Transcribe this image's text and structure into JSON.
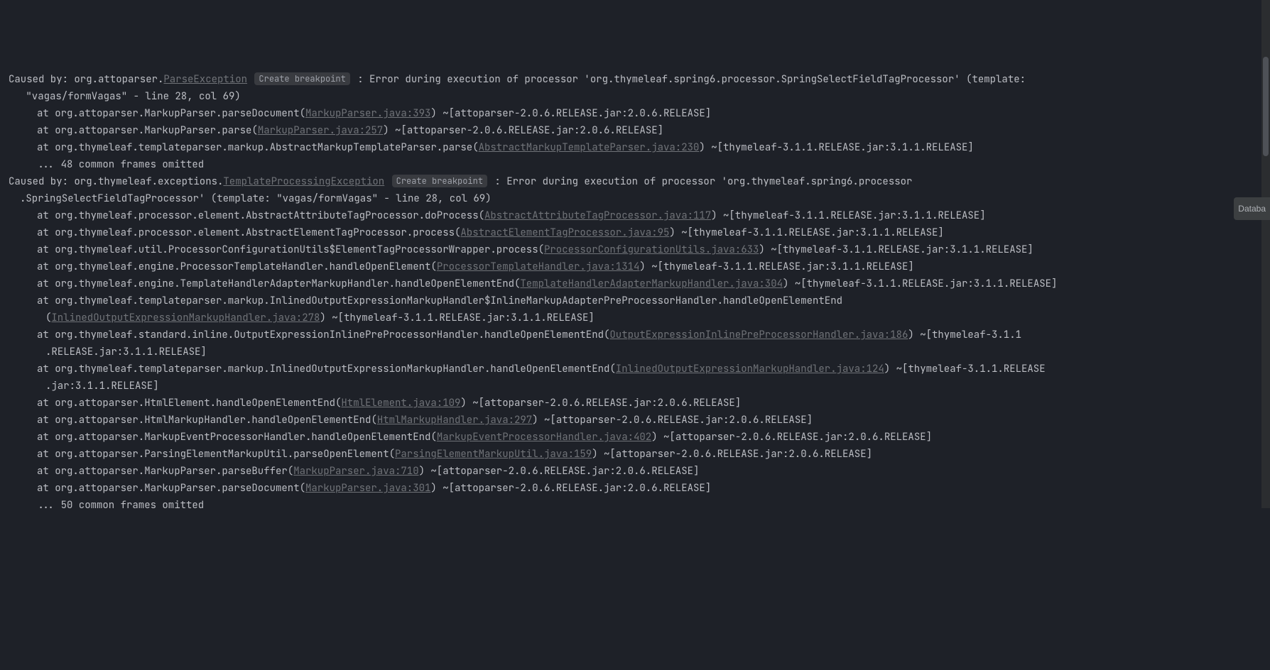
{
  "labels": {
    "create_breakpoint": "Create breakpoint",
    "database_tab": "Databa"
  },
  "lines": [
    {
      "indent": 0,
      "segs": [
        {
          "t": "Caused by: org.attoparser."
        },
        {
          "t": "ParseException",
          "link": true
        },
        {
          "t": " "
        },
        {
          "bp": true
        },
        {
          "t": " : Error during execution of processor 'org.thymeleaf.spring6.processor.SpringSelectFieldTagProcessor' (template:"
        }
      ]
    },
    {
      "indent": 1,
      "segs": [
        {
          "t": " \"vagas/formVagas\" - line 28, col 69)"
        }
      ]
    },
    {
      "indent": 2,
      "segs": [
        {
          "t": "at org.attoparser.MarkupParser.parseDocument("
        },
        {
          "t": "MarkupParser.java:393",
          "link": true
        },
        {
          "t": ") ~[attoparser-2.0.6.RELEASE.jar:2.0.6.RELEASE]"
        }
      ]
    },
    {
      "indent": 2,
      "segs": [
        {
          "t": "at org.attoparser.MarkupParser.parse("
        },
        {
          "t": "MarkupParser.java:257",
          "link": true
        },
        {
          "t": ") ~[attoparser-2.0.6.RELEASE.jar:2.0.6.RELEASE]"
        }
      ]
    },
    {
      "indent": 2,
      "segs": [
        {
          "t": "at org.thymeleaf.templateparser.markup.AbstractMarkupTemplateParser.parse("
        },
        {
          "t": "AbstractMarkupTemplateParser.java:230",
          "link": true
        },
        {
          "t": ") ~[thymeleaf-3.1.1.RELEASE.jar:3.1.1.RELEASE]"
        }
      ]
    },
    {
      "indent": 2,
      "segs": [
        {
          "t": "... 48 common frames omitted"
        }
      ]
    },
    {
      "indent": 0,
      "segs": [
        {
          "t": "Caused by: org.thymeleaf.exceptions."
        },
        {
          "t": "TemplateProcessingException",
          "link": true
        },
        {
          "t": " "
        },
        {
          "bp": true
        },
        {
          "t": " : Error during execution of processor 'org.thymeleaf.spring6.processor"
        }
      ]
    },
    {
      "indent": 1,
      "segs": [
        {
          "t": ".SpringSelectFieldTagProcessor' (template: \"vagas/formVagas\" - line 28, col 69)"
        }
      ]
    },
    {
      "indent": 2,
      "segs": [
        {
          "t": "at org.thymeleaf.processor.element.AbstractAttributeTagProcessor.doProcess("
        },
        {
          "t": "AbstractAttributeTagProcessor.java:117",
          "link": true
        },
        {
          "t": ") ~[thymeleaf-3.1.1.RELEASE.jar:3.1.1.RELEASE]"
        }
      ]
    },
    {
      "indent": 2,
      "segs": [
        {
          "t": "at org.thymeleaf.processor.element.AbstractElementTagProcessor.process("
        },
        {
          "t": "AbstractElementTagProcessor.java:95",
          "link": true
        },
        {
          "t": ") ~[thymeleaf-3.1.1.RELEASE.jar:3.1.1.RELEASE]"
        }
      ]
    },
    {
      "indent": 2,
      "segs": [
        {
          "t": "at org.thymeleaf.util.ProcessorConfigurationUtils$ElementTagProcessorWrapper.process("
        },
        {
          "t": "ProcessorConfigurationUtils.java:633",
          "link": true
        },
        {
          "t": ") ~[thymeleaf-3.1.1.RELEASE.jar:3.1.1.RELEASE]"
        }
      ]
    },
    {
      "indent": 2,
      "segs": [
        {
          "t": "at org.thymeleaf.engine.ProcessorTemplateHandler.handleOpenElement("
        },
        {
          "t": "ProcessorTemplateHandler.java:1314",
          "link": true
        },
        {
          "t": ") ~[thymeleaf-3.1.1.RELEASE.jar:3.1.1.RELEASE]"
        }
      ]
    },
    {
      "indent": 2,
      "segs": [
        {
          "t": "at org.thymeleaf.engine.TemplateHandlerAdapterMarkupHandler.handleOpenElementEnd("
        },
        {
          "t": "TemplateHandlerAdapterMarkupHandler.java:304",
          "link": true
        },
        {
          "t": ") ~[thymeleaf-3.1.1.RELEASE.jar:3.1.1.RELEASE]"
        }
      ]
    },
    {
      "indent": 2,
      "segs": [
        {
          "t": "at org.thymeleaf.templateparser.markup.InlinedOutputExpressionMarkupHandler$InlineMarkupAdapterPreProcessorHandler.handleOpenElementEnd"
        }
      ]
    },
    {
      "indent": 3,
      "segs": [
        {
          "t": "("
        },
        {
          "t": "InlinedOutputExpressionMarkupHandler.java:278",
          "link": true
        },
        {
          "t": ") ~[thymeleaf-3.1.1.RELEASE.jar:3.1.1.RELEASE]"
        }
      ]
    },
    {
      "indent": 2,
      "segs": [
        {
          "t": "at org.thymeleaf.standard.inline.OutputExpressionInlinePreProcessorHandler.handleOpenElementEnd("
        },
        {
          "t": "OutputExpressionInlinePreProcessorHandler.java:186",
          "link": true
        },
        {
          "t": ") ~[thymeleaf-3.1.1"
        }
      ]
    },
    {
      "indent": 3,
      "segs": [
        {
          "t": ".RELEASE.jar:3.1.1.RELEASE]"
        }
      ]
    },
    {
      "indent": 2,
      "segs": [
        {
          "t": "at org.thymeleaf.templateparser.markup.InlinedOutputExpressionMarkupHandler.handleOpenElementEnd("
        },
        {
          "t": "InlinedOutputExpressionMarkupHandler.java:124",
          "link": true
        },
        {
          "t": ") ~[thymeleaf-3.1.1.RELEASE"
        }
      ]
    },
    {
      "indent": 3,
      "segs": [
        {
          "t": ".jar:3.1.1.RELEASE]"
        }
      ]
    },
    {
      "indent": 2,
      "segs": [
        {
          "t": "at org.attoparser.HtmlElement.handleOpenElementEnd("
        },
        {
          "t": "HtmlElement.java:109",
          "link": true
        },
        {
          "t": ") ~[attoparser-2.0.6.RELEASE.jar:2.0.6.RELEASE]"
        }
      ]
    },
    {
      "indent": 2,
      "segs": [
        {
          "t": "at org.attoparser.HtmlMarkupHandler.handleOpenElementEnd("
        },
        {
          "t": "HtmlMarkupHandler.java:297",
          "link": true
        },
        {
          "t": ") ~[attoparser-2.0.6.RELEASE.jar:2.0.6.RELEASE]"
        }
      ]
    },
    {
      "indent": 2,
      "segs": [
        {
          "t": "at org.attoparser.MarkupEventProcessorHandler.handleOpenElementEnd("
        },
        {
          "t": "MarkupEventProcessorHandler.java:402",
          "link": true
        },
        {
          "t": ") ~[attoparser-2.0.6.RELEASE.jar:2.0.6.RELEASE]"
        }
      ]
    },
    {
      "indent": 2,
      "segs": [
        {
          "t": "at org.attoparser.ParsingElementMarkupUtil.parseOpenElement("
        },
        {
          "t": "ParsingElementMarkupUtil.java:159",
          "link": true
        },
        {
          "t": ") ~[attoparser-2.0.6.RELEASE.jar:2.0.6.RELEASE]"
        }
      ]
    },
    {
      "indent": 2,
      "segs": [
        {
          "t": "at org.attoparser.MarkupParser.parseBuffer("
        },
        {
          "t": "MarkupParser.java:710",
          "link": true
        },
        {
          "t": ") ~[attoparser-2.0.6.RELEASE.jar:2.0.6.RELEASE]"
        }
      ]
    },
    {
      "indent": 2,
      "segs": [
        {
          "t": "at org.attoparser.MarkupParser.parseDocument("
        },
        {
          "t": "MarkupParser.java:301",
          "link": true
        },
        {
          "t": ") ~[attoparser-2.0.6.RELEASE.jar:2.0.6.RELEASE]"
        }
      ]
    },
    {
      "indent": 2,
      "segs": [
        {
          "t": "... 50 common frames omitted"
        }
      ]
    }
  ]
}
